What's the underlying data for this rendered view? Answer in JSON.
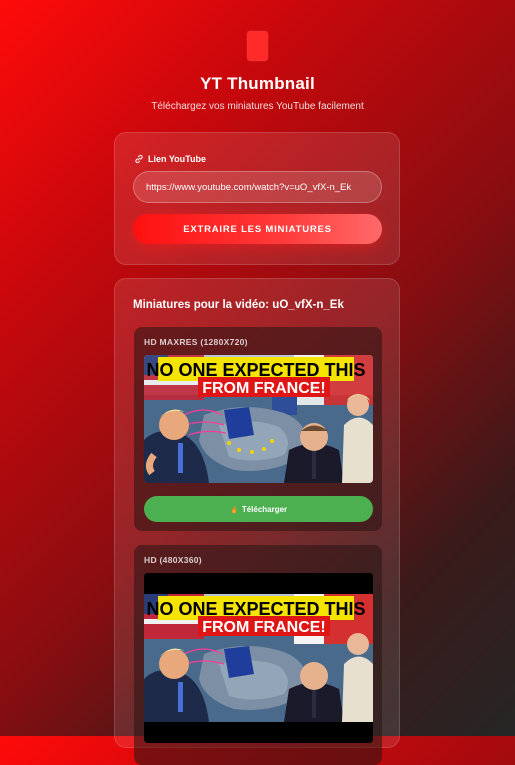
{
  "header": {
    "title": "YT Thumbnail",
    "subtitle": "Téléchargez vos miniatures YouTube facilement"
  },
  "form": {
    "label": "Lien YouTube",
    "url_value": "https://www.youtube.com/watch?v=uO_vfX-n_Ek",
    "extract_label": "EXTRAIRE LES MINIATURES"
  },
  "results": {
    "title": "Miniatures pour la vidéo: uO_vfX-n_Ek",
    "thumbnails": [
      {
        "label": "HD MAXRES (1280X720)",
        "headline_1": "NO ONE EXPECTED THIS",
        "headline_2": "FROM FRANCE!",
        "download_label": "Télécharger"
      },
      {
        "label": "HD (480X360)",
        "headline_1": "NO ONE EXPECTED THIS",
        "headline_2": "FROM FRANCE!"
      }
    ]
  },
  "colors": {
    "accent": "#ff1010",
    "download": "#4caf50",
    "headline_box": "#f5e400"
  }
}
